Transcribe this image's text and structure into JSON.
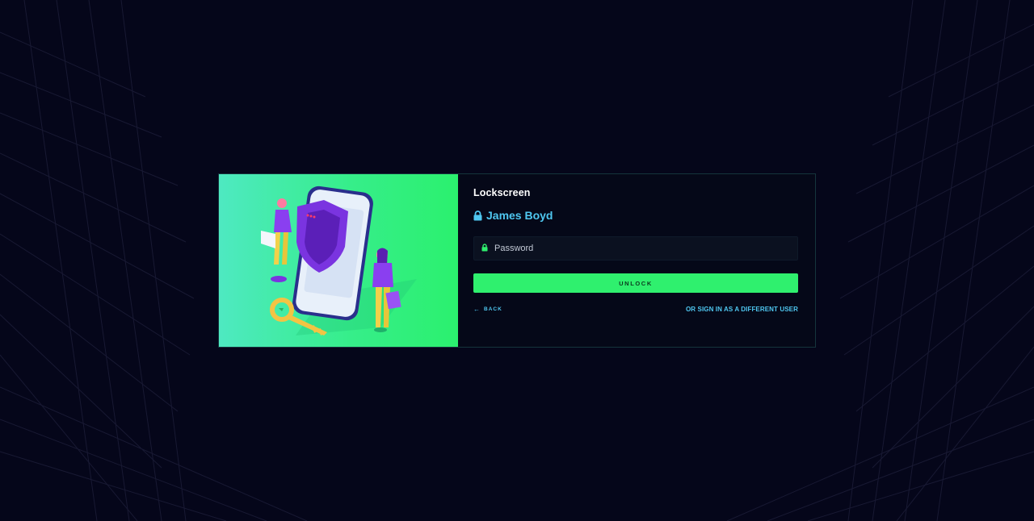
{
  "lockscreen": {
    "title": "Lockscreen",
    "user_name": "James Boyd",
    "password_placeholder": "Password",
    "unlock_label": "UNLOCK",
    "back_label": "BACK",
    "different_user_label": "OR SIGN IN AS A DIFFERENT USER"
  },
  "icons": {
    "user_lock": "lock-icon",
    "password_lock": "lock-icon",
    "back_arrow": "arrow-left-icon"
  },
  "colors": {
    "background": "#05061a",
    "accent_green": "#2ff06e",
    "link_blue": "#4fc7f0",
    "input_bg": "#0b1120"
  }
}
